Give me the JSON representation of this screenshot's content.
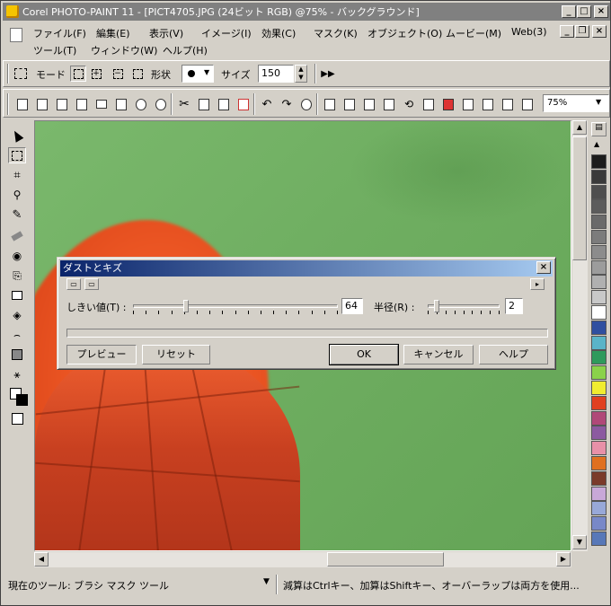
{
  "window": {
    "title": "Corel PHOTO-PAINT 11 - [PICT4705.JPG (24ビット RGB) @75% - バックグラウンド]",
    "minimize": "_",
    "maximize": "□",
    "close": "×"
  },
  "menu": {
    "row1": [
      "ファイル(F)",
      "編集(E)",
      "表示(V)",
      "イメージ(I)",
      "効果(C)",
      "マスク(K)",
      "オブジェクト(O)",
      "ムービー(M)",
      "Web(3)"
    ],
    "row2": [
      "ツール(T)",
      "ウィンドウ(W)",
      "ヘルプ(H)"
    ]
  },
  "property_bar": {
    "mode_label": "モード",
    "shape_label": "形状",
    "size_label": "サイズ",
    "size_value": "150"
  },
  "zoom": {
    "value": "75%"
  },
  "dialog": {
    "title": "ダストとキズ",
    "threshold_label": "しきい値(T) :",
    "threshold_value": "64",
    "threshold_level": 64,
    "threshold_max": 255,
    "radius_label": "半径(R) :",
    "radius_value": "2",
    "radius_level": 2,
    "radius_max": 20,
    "preview_button": "プレビュー",
    "reset_button": "リセット",
    "ok_button": "OK",
    "cancel_button": "キャンセル",
    "help_button": "ヘルプ"
  },
  "status": {
    "current_tool": "現在のツール: ブラシ マスク ツール",
    "hint": "減算はCtrlキー、加算はShiftキー、オーバーラップは両方を使用..."
  },
  "colors": {
    "palette": [
      "#1c1c1c",
      "#3a3a3a",
      "#4e4e4e",
      "#5c5c5c",
      "#6a6a6a",
      "#7c7c7c",
      "#8c8c8c",
      "#9c9c9c",
      "#b0b0b0",
      "#c8c8c8",
      "#ffffff",
      "#2f4fa0",
      "#5ab4c8",
      "#2e9a5c",
      "#8ad24a",
      "#f0ec30",
      "#e04020",
      "#b04878",
      "#8c5aa0",
      "#e890a8",
      "#e07020",
      "#7a3a2a",
      "#c8a8d8",
      "#98a8d8",
      "#7888c8",
      "#5878b8"
    ],
    "titlebar_inactive": "#808080",
    "dialog_titlebar_start": "#0a246a",
    "dialog_titlebar_end": "#a6caf0",
    "canvas_green": "#6fae61",
    "wing_orange": "#e04a1c"
  }
}
